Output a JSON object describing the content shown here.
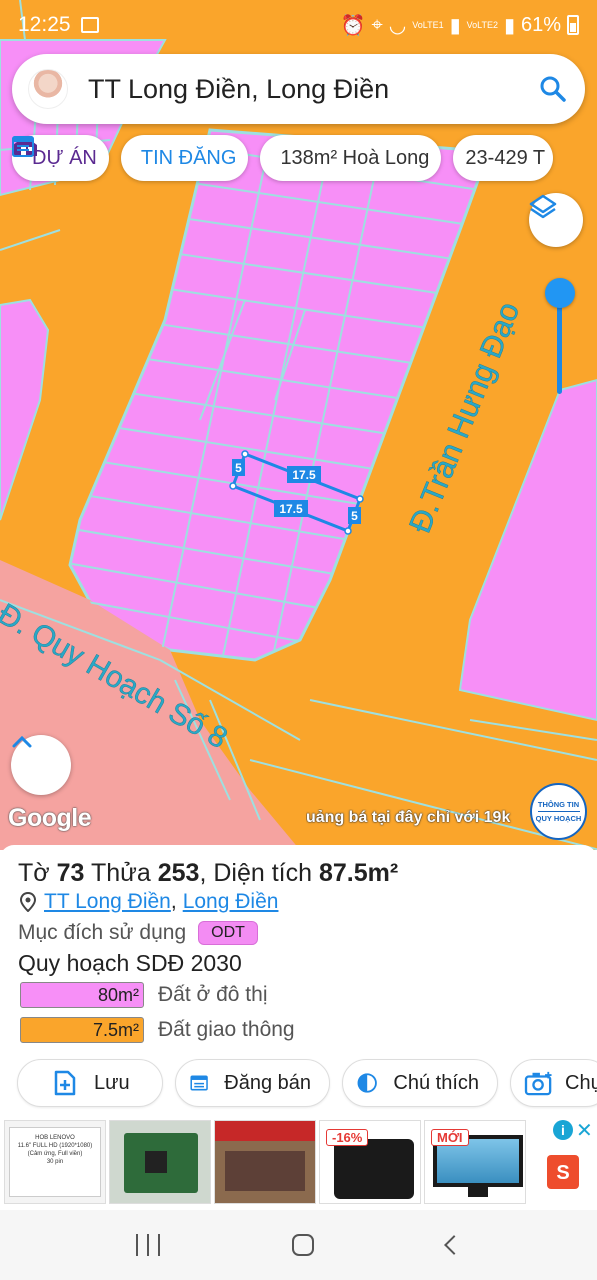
{
  "status_bar": {
    "time": "12:25",
    "sim1_label": "VoLTE1",
    "sim2_label": "VoLTE2",
    "battery": "61%"
  },
  "search": {
    "title": "TT Long Điền, Long Điền",
    "icon": "search-icon"
  },
  "chips": [
    {
      "label": "DỰ ÁN",
      "icon": "house-icon"
    },
    {
      "label": "TIN ĐĂNG",
      "icon": "listing-icon"
    },
    {
      "label": "138m² Hoà Long",
      "icon": "listing-icon"
    },
    {
      "label": "23-429 T",
      "icon": ""
    }
  ],
  "map": {
    "streets": {
      "main": "Đ.Trần Hưng Đạo",
      "side": "Đ. Quy Hoạch Số 8"
    },
    "parcel_dimensions": {
      "top": "17.5",
      "bottom": "17.5",
      "left": "5",
      "right": "5"
    },
    "attribution": "Google",
    "promo_text": "uảng bá tại đây chỉ với 19k",
    "logo_lines": [
      "THÔNG TIN",
      "QUY HOẠCH"
    ],
    "colors": {
      "residential": "#f78ff7",
      "road": "#faa52b",
      "other": "#f5a3a0",
      "boundary": "#9ee0e0",
      "highlight": "#1e88e5"
    },
    "opacity_level": 1.0
  },
  "parcel": {
    "sheet_label": "Tờ",
    "sheet": "73",
    "lot_label": "Thửa",
    "lot": "253",
    "area_label": ", Diện tích",
    "area": "87.5m²",
    "town": "TT Long Điền",
    "separator": ",",
    "district": "Long Điền",
    "purpose_label": "Mục đích sử dụng",
    "purpose_code": "ODT",
    "plan_title": "Quy hoạch SDĐ 2030",
    "legend": [
      {
        "value": "80m²",
        "label": "Đất ở đô thị",
        "color": "#f78ff7"
      },
      {
        "value": "7.5m²",
        "label": "Đất giao thông",
        "color": "#faa52b"
      }
    ]
  },
  "actions": [
    {
      "label": "Lưu",
      "icon": "add-document-icon"
    },
    {
      "label": "Đăng bán",
      "icon": "calendar-list-icon"
    },
    {
      "label": "Chú thích",
      "icon": "half-circle-icon"
    },
    {
      "label": "Chụ",
      "icon": "camera-icon"
    }
  ],
  "ad": {
    "items": [
      {
        "name": "laptop-screen-product",
        "tag": ""
      },
      {
        "name": "circuit-board-product",
        "tag": ""
      },
      {
        "name": "shop-storefront-product",
        "tag": ""
      },
      {
        "name": "receipt-printer-product",
        "tag": "-16%"
      },
      {
        "name": "monitor-product",
        "tag": "MỚI"
      }
    ],
    "info_icon": "i",
    "close_icon": "✕",
    "brand": "S",
    "screen_text": [
      "HOB LENOVO",
      "11.6\" FULL HD (1920*1080)",
      "(Cảm ứng, Full viền)",
      "30 pin"
    ]
  },
  "nav": {
    "recent": "recent-apps-button",
    "home": "home-button",
    "back": "back-button"
  }
}
